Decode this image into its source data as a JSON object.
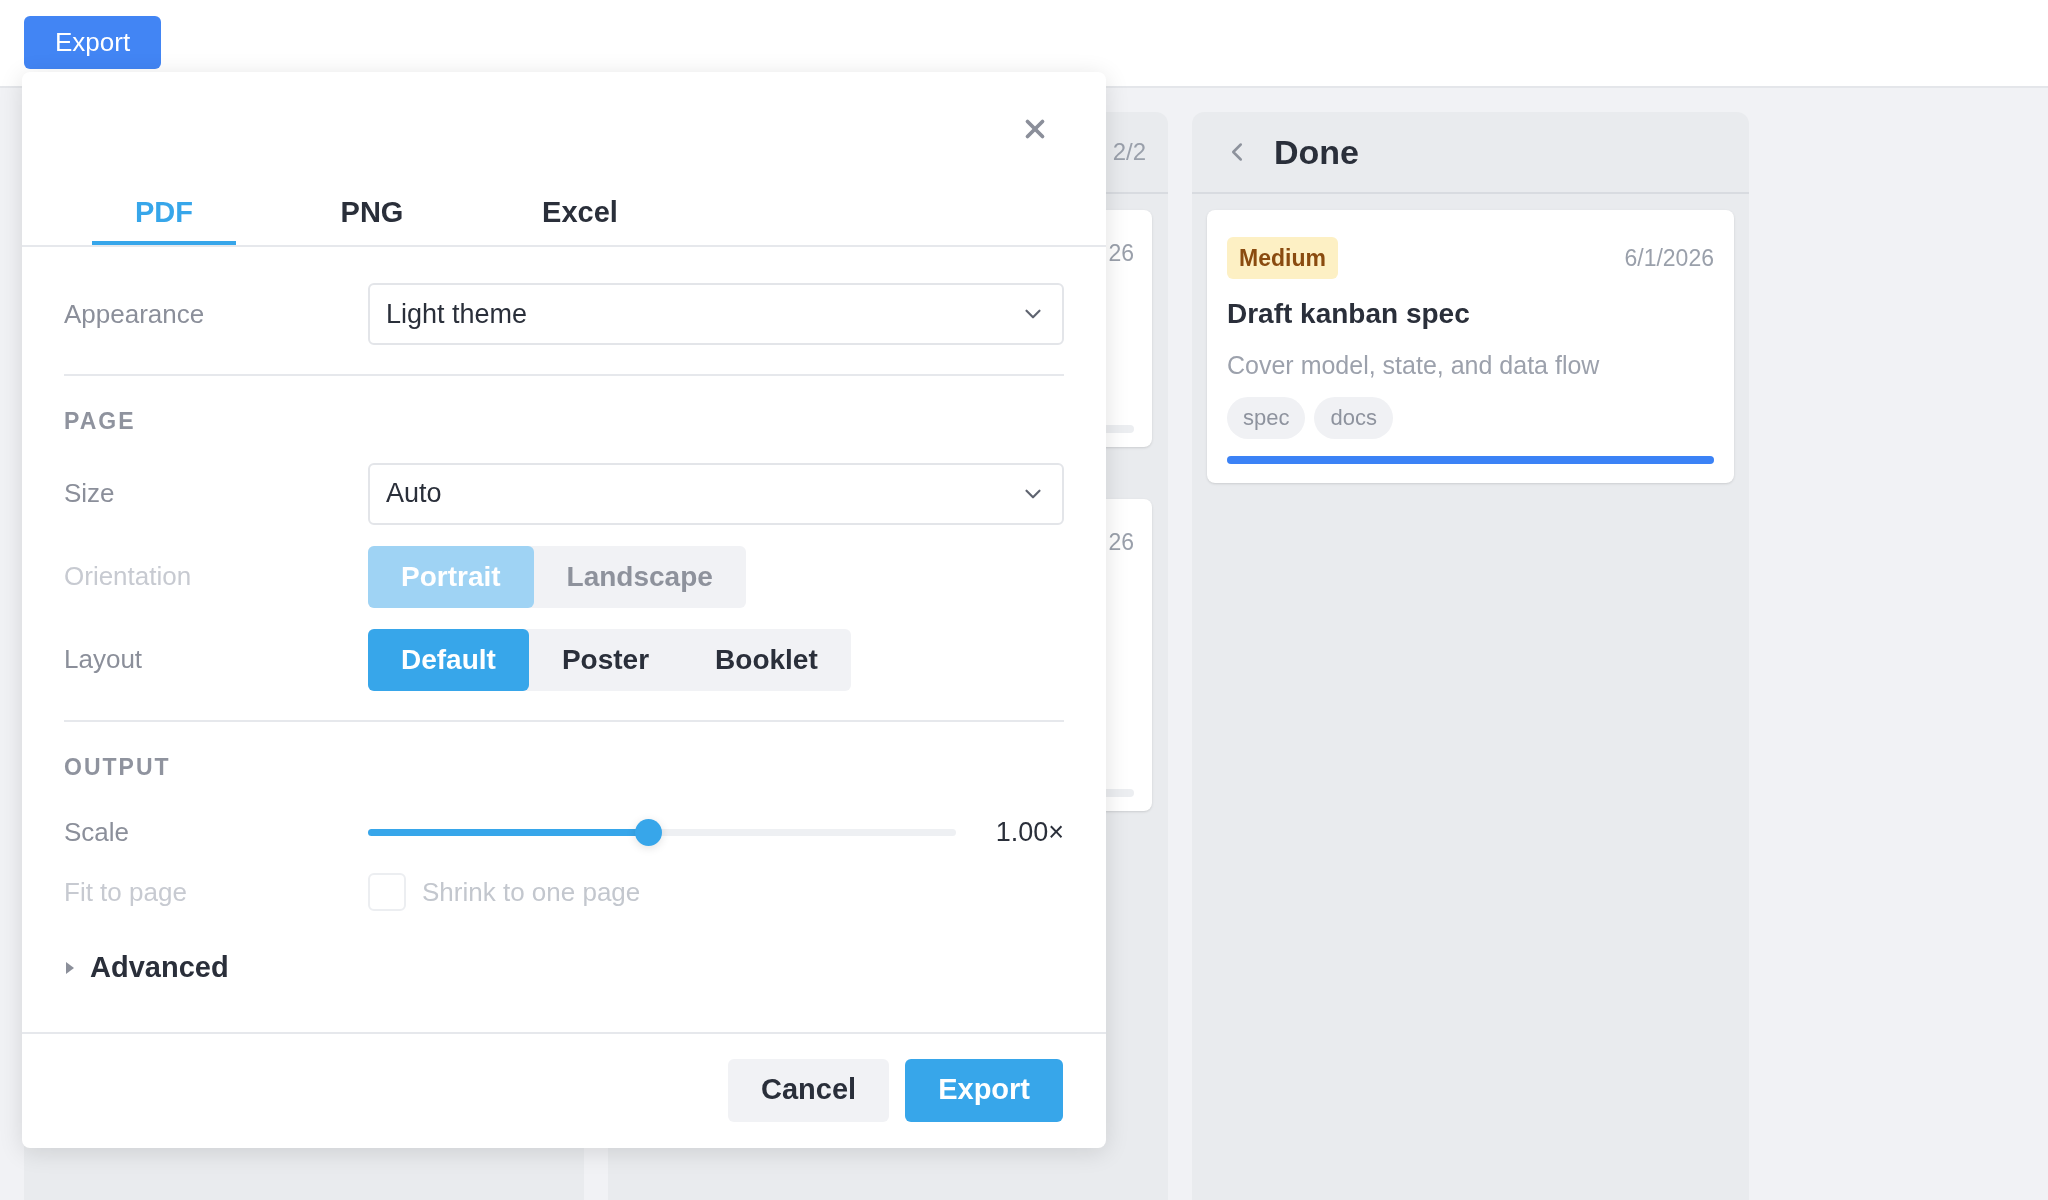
{
  "top_bar": {
    "export_button": "Export"
  },
  "board": {
    "columns": [
      {
        "kind": "partial",
        "counter": "2/2",
        "cards": [
          {
            "date": "26"
          },
          {
            "date": "26"
          }
        ]
      },
      {
        "kind": "full",
        "title": "Done",
        "cards": [
          {
            "priority": "Medium",
            "date": "6/1/2026",
            "title": "Draft kanban spec",
            "description": "Cover model, state, and data flow",
            "tags": [
              "spec",
              "docs"
            ],
            "level": 1
          }
        ]
      }
    ]
  },
  "dialog": {
    "tabs": [
      {
        "label": "PDF",
        "selected": true
      },
      {
        "label": "PNG",
        "selected": false
      },
      {
        "label": "Excel",
        "selected": false
      }
    ],
    "sections": [
      {
        "rows": [
          {
            "kind": "select",
            "label": "Appearance",
            "value": "Light theme"
          }
        ]
      },
      {
        "heading": "PAGE",
        "rows": [
          {
            "kind": "select",
            "label": "Size",
            "value": "Auto"
          },
          {
            "kind": "segmented",
            "label": "Orientation",
            "disabled": true,
            "options": [
              {
                "label": "Portrait",
                "selected": true
              },
              {
                "label": "Landscape",
                "selected": false
              }
            ]
          },
          {
            "kind": "segmented",
            "label": "Layout",
            "disabled": false,
            "options": [
              {
                "label": "Default",
                "selected": true
              },
              {
                "label": "Poster",
                "selected": false
              },
              {
                "label": "Booklet",
                "selected": false
              }
            ]
          }
        ]
      },
      {
        "heading": "OUTPUT",
        "rows": [
          {
            "kind": "slider",
            "label": "Scale",
            "level": 0.476,
            "reading": "1.00×"
          },
          {
            "kind": "checkbox",
            "label": "Fit to page",
            "disabled": true,
            "checked": false,
            "text": "Shrink to one page"
          }
        ]
      }
    ],
    "advanced": {
      "label": "Advanced",
      "expanded": false
    },
    "buttons": [
      {
        "label": "Cancel",
        "kind": "secondary"
      },
      {
        "label": "Export",
        "kind": "primary"
      }
    ]
  }
}
